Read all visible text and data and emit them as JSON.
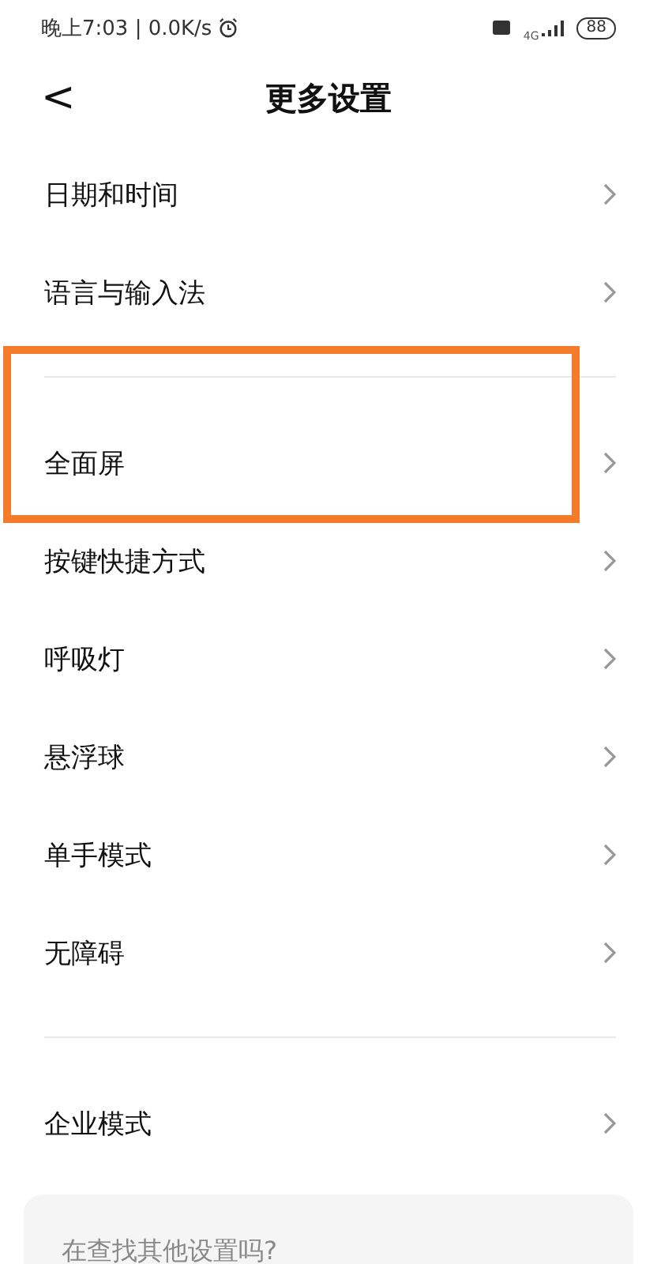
{
  "status_bar": {
    "time": "晚上7:03 | 0.0K/s",
    "network": "4G",
    "battery": "88"
  },
  "header": {
    "back": "<",
    "title": "更多设置"
  },
  "groups": [
    {
      "items": [
        {
          "label": "日期和时间",
          "highlighted": false
        },
        {
          "label": "语言与输入法",
          "highlighted": false
        }
      ]
    },
    {
      "items": [
        {
          "label": "全面屏",
          "highlighted": true
        },
        {
          "label": "按键快捷方式",
          "highlighted": false
        },
        {
          "label": "呼吸灯",
          "highlighted": false
        },
        {
          "label": "悬浮球",
          "highlighted": false
        },
        {
          "label": "单手模式",
          "highlighted": false
        },
        {
          "label": "无障碍",
          "highlighted": false
        }
      ]
    },
    {
      "items": [
        {
          "label": "企业模式",
          "highlighted": false
        }
      ]
    }
  ],
  "search_card": {
    "title": "在查找其他设置吗?"
  }
}
